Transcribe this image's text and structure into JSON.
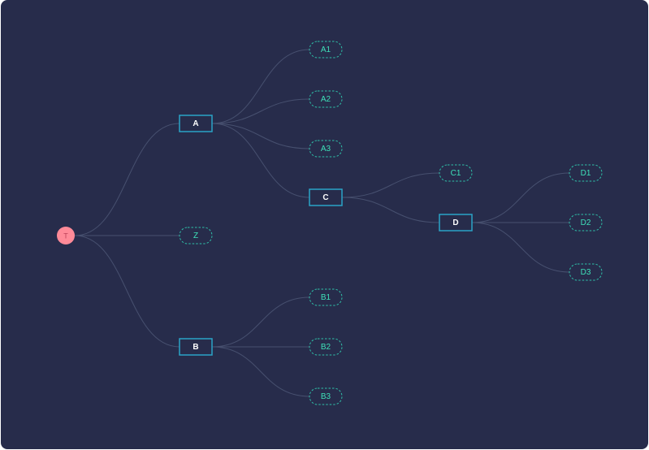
{
  "diagram": {
    "type": "tree",
    "nodes": [
      {
        "id": "T",
        "label": "T",
        "shape": "circle"
      },
      {
        "id": "A",
        "label": "A",
        "shape": "rect"
      },
      {
        "id": "Z",
        "label": "Z",
        "shape": "pill"
      },
      {
        "id": "B",
        "label": "B",
        "shape": "rect"
      },
      {
        "id": "A1",
        "label": "A1",
        "shape": "pill"
      },
      {
        "id": "A2",
        "label": "A2",
        "shape": "pill"
      },
      {
        "id": "A3",
        "label": "A3",
        "shape": "pill"
      },
      {
        "id": "C",
        "label": "C",
        "shape": "rect"
      },
      {
        "id": "B1",
        "label": "B1",
        "shape": "pill"
      },
      {
        "id": "B2",
        "label": "B2",
        "shape": "pill"
      },
      {
        "id": "B3",
        "label": "B3",
        "shape": "pill"
      },
      {
        "id": "C1",
        "label": "C1",
        "shape": "pill"
      },
      {
        "id": "D",
        "label": "D",
        "shape": "rect"
      },
      {
        "id": "D1",
        "label": "D1",
        "shape": "pill"
      },
      {
        "id": "D2",
        "label": "D2",
        "shape": "pill"
      },
      {
        "id": "D3",
        "label": "D3",
        "shape": "pill"
      }
    ],
    "edges": [
      {
        "from": "T",
        "to": "A"
      },
      {
        "from": "T",
        "to": "Z"
      },
      {
        "from": "T",
        "to": "B"
      },
      {
        "from": "A",
        "to": "A1"
      },
      {
        "from": "A",
        "to": "A2"
      },
      {
        "from": "A",
        "to": "A3"
      },
      {
        "from": "A",
        "to": "C"
      },
      {
        "from": "B",
        "to": "B1"
      },
      {
        "from": "B",
        "to": "B2"
      },
      {
        "from": "B",
        "to": "B3"
      },
      {
        "from": "C",
        "to": "C1"
      },
      {
        "from": "C",
        "to": "D"
      },
      {
        "from": "D",
        "to": "D1"
      },
      {
        "from": "D",
        "to": "D2"
      },
      {
        "from": "D",
        "to": "D3"
      }
    ],
    "colors": {
      "background": "#272c4b",
      "edge": "#47506f",
      "rect_border": "#2aa3c8",
      "pill_border": "#2fbfa8",
      "pill_text": "#3ee0b8",
      "rect_text": "#ffffff",
      "root_fill": "#ff8a98",
      "root_text": "#c0455b"
    }
  }
}
